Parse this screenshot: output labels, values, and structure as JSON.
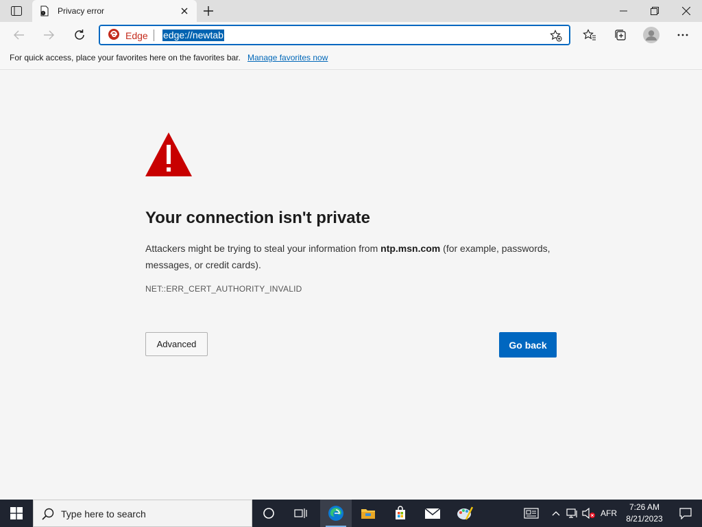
{
  "tab": {
    "title": "Privacy error"
  },
  "address": {
    "site_label": "Edge",
    "url": "edge://newtab"
  },
  "favorites_bar": {
    "prompt": "For quick access, place your favorites here on the favorites bar.",
    "link": "Manage favorites now"
  },
  "error": {
    "title": "Your connection isn't private",
    "desc_before": "Attackers might be trying to steal your information from ",
    "host": "ntp.msn.com",
    "desc_after": " (for example, passwords, messages, or credit cards).",
    "code": "NET::ERR_CERT_AUTHORITY_INVALID",
    "advanced_label": "Advanced",
    "go_back_label": "Go back"
  },
  "taskbar": {
    "search_placeholder": "Type here to search",
    "language": "AFR",
    "time": "7:26 AM",
    "date": "8/21/2023"
  },
  "colors": {
    "accent": "#0067c0",
    "warning_red": "#c80000",
    "taskbar": "#1f2430"
  },
  "icons": [
    "tab-actions-icon",
    "privacy-favicon",
    "close-icon",
    "plus-icon",
    "minimize-icon",
    "restore-icon",
    "back-icon",
    "forward-icon",
    "refresh-icon",
    "edge-logo-icon",
    "add-favorite-icon",
    "favorites-icon",
    "collections-icon",
    "profile-icon",
    "more-icon",
    "warning-icon",
    "windows-start-icon",
    "search-icon",
    "cortana-icon",
    "task-view-icon",
    "edge-taskbar-icon",
    "file-explorer-icon",
    "store-icon",
    "mail-icon",
    "paint-icon",
    "news-icon",
    "chevron-up-icon",
    "network-icon",
    "volume-muted-icon",
    "notification-icon"
  ]
}
